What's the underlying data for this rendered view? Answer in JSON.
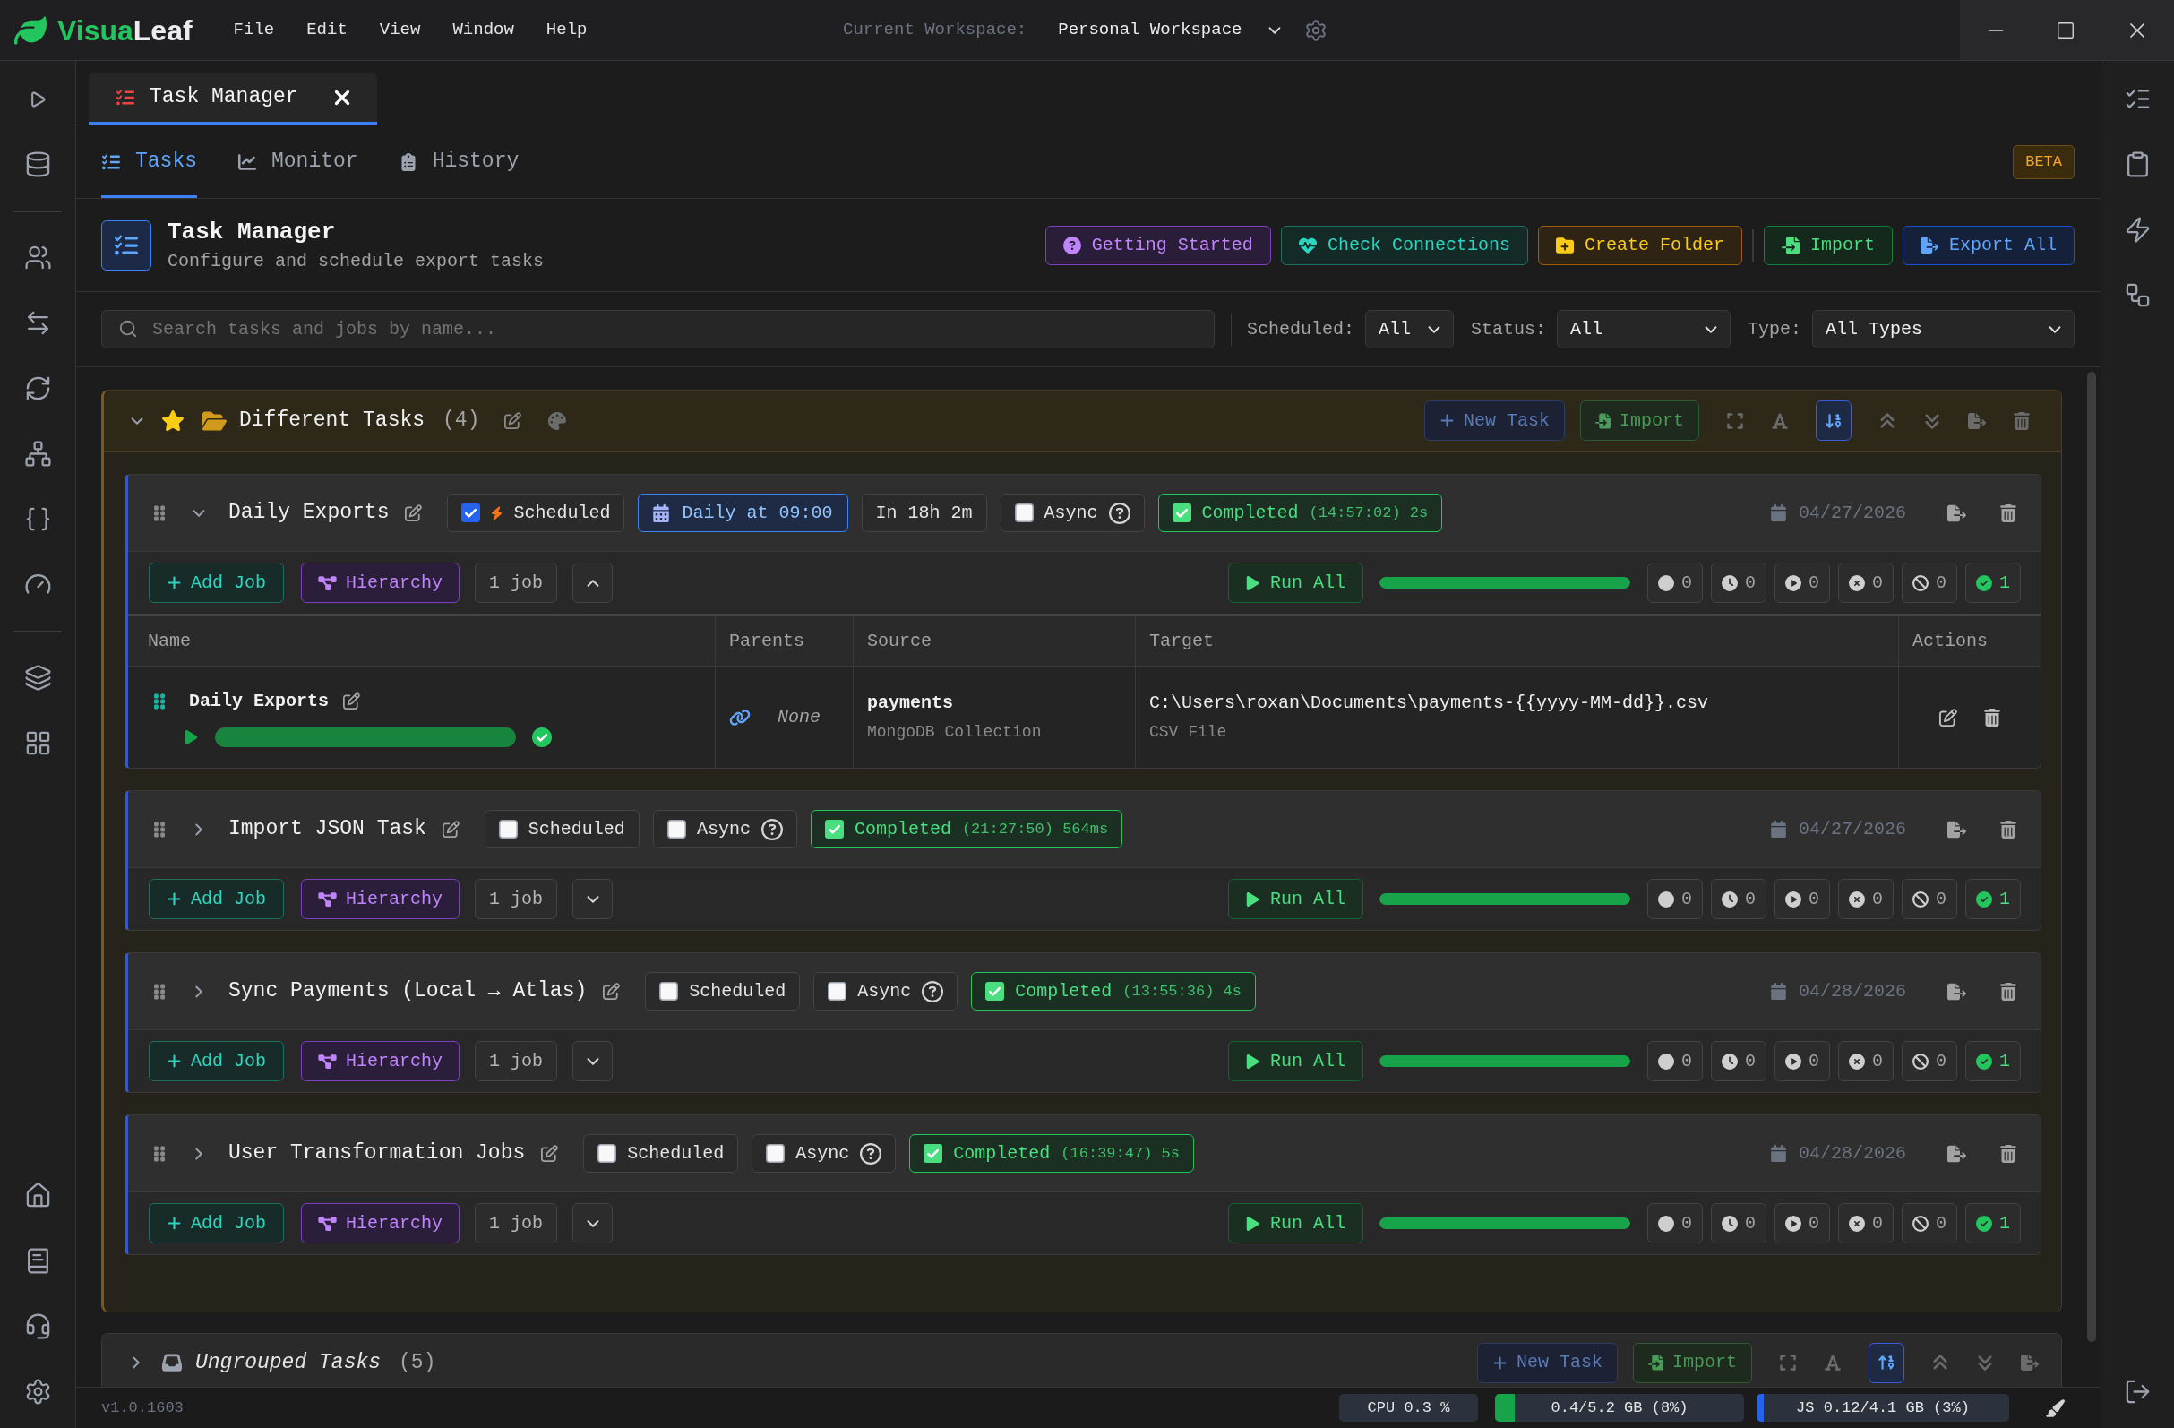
{
  "logo": {
    "accent": "Visua",
    "rest": "Leaf"
  },
  "menu": [
    "File",
    "Edit",
    "View",
    "Window",
    "Help"
  ],
  "workspace": {
    "label": "Current Workspace:",
    "value": "Personal Workspace"
  },
  "document_tabs": [
    {
      "label": "Task Manager",
      "selected": true
    }
  ],
  "view_tabs": [
    {
      "label": "Tasks",
      "selected": true
    },
    {
      "label": "Monitor",
      "selected": false
    },
    {
      "label": "History",
      "selected": false
    }
  ],
  "badge": "BETA",
  "header": {
    "title": "Task Manager",
    "subtitle": "Configure and schedule export tasks"
  },
  "setup_actions": [
    {
      "kind": "help",
      "label": "Getting Started"
    },
    {
      "kind": "connections",
      "label": "Check Connections"
    },
    {
      "kind": "folder",
      "label": "Create Folder"
    }
  ],
  "data_actions": [
    {
      "kind": "import",
      "label": "Import"
    },
    {
      "kind": "export",
      "label": "Export All"
    }
  ],
  "search": {
    "placeholder": "Search tasks and jobs by name..."
  },
  "filters": [
    {
      "label": "Scheduled:",
      "value": "All"
    },
    {
      "label": "Status:",
      "value": "All"
    },
    {
      "label": "Type:",
      "value": "All Types"
    }
  ],
  "groups": [
    {
      "kind": "folder",
      "name": "Different Tasks",
      "count": "(4)",
      "expanded": true,
      "starred": true,
      "new_task": "New Task",
      "import": "Import",
      "tasks": [
        {
          "name": "Daily Exports",
          "expanded": true,
          "scheduled": {
            "label": "Scheduled",
            "checked": true
          },
          "schedule": "Daily at 09:00",
          "next_run": "In 18h 2m",
          "async": {
            "label": "Async",
            "checked": false
          },
          "status": {
            "kind": "completed",
            "label": "Completed",
            "detail": "(14:57:02) 2s"
          },
          "date": "04/27/2026",
          "add_job": "Add Job",
          "hierarchy": "Hierarchy",
          "job_count": "1 job",
          "run_all": "Run All",
          "level": 1,
          "counters": [
            {
              "kind": "dot",
              "value": "0"
            },
            {
              "kind": "clock",
              "value": "0"
            },
            {
              "kind": "play",
              "value": "0"
            },
            {
              "kind": "cross",
              "value": "0"
            },
            {
              "kind": "ban",
              "value": "0"
            },
            {
              "kind": "check",
              "value": "1"
            }
          ],
          "jobs": {
            "columns": [
              "Name",
              "Parents",
              "Source",
              "Target",
              "Actions"
            ],
            "rows": [
              {
                "name": "Daily Exports",
                "level": 1,
                "parents": "None",
                "source": "payments",
                "source_type": "MongoDB Collection",
                "target": "C:\\Users\\roxan\\Documents\\payments-{{yyyy-MM-dd}}.csv",
                "target_type": "CSV File"
              }
            ]
          }
        },
        {
          "name": "Import JSON Task",
          "expanded": false,
          "scheduled": {
            "label": "Scheduled",
            "checked": false
          },
          "async": {
            "label": "Async",
            "checked": false
          },
          "status": {
            "kind": "completed",
            "label": "Completed",
            "detail": "(21:27:50) 564ms"
          },
          "date": "04/27/2026",
          "add_job": "Add Job",
          "hierarchy": "Hierarchy",
          "job_count": "1 job",
          "run_all": "Run All",
          "level": 1,
          "counters": [
            {
              "kind": "dot",
              "value": "0"
            },
            {
              "kind": "clock",
              "value": "0"
            },
            {
              "kind": "play",
              "value": "0"
            },
            {
              "kind": "cross",
              "value": "0"
            },
            {
              "kind": "ban",
              "value": "0"
            },
            {
              "kind": "check",
              "value": "1"
            }
          ]
        },
        {
          "name": "Sync Payments (Local → Atlas)",
          "expanded": false,
          "scheduled": {
            "label": "Scheduled",
            "checked": false
          },
          "async": {
            "label": "Async",
            "checked": false
          },
          "status": {
            "kind": "completed",
            "label": "Completed",
            "detail": "(13:55:36) 4s"
          },
          "date": "04/28/2026",
          "add_job": "Add Job",
          "hierarchy": "Hierarchy",
          "job_count": "1 job",
          "run_all": "Run All",
          "level": 1,
          "counters": [
            {
              "kind": "dot",
              "value": "0"
            },
            {
              "kind": "clock",
              "value": "0"
            },
            {
              "kind": "play",
              "value": "0"
            },
            {
              "kind": "cross",
              "value": "0"
            },
            {
              "kind": "ban",
              "value": "0"
            },
            {
              "kind": "check",
              "value": "1"
            }
          ]
        },
        {
          "name": "User Transformation Jobs",
          "expanded": false,
          "scheduled": {
            "label": "Scheduled",
            "checked": false
          },
          "async": {
            "label": "Async",
            "checked": false
          },
          "status": {
            "kind": "completed",
            "label": "Completed",
            "detail": "(16:39:47) 5s"
          },
          "date": "04/28/2026",
          "add_job": "Add Job",
          "hierarchy": "Hierarchy",
          "job_count": "1 job",
          "run_all": "Run All",
          "level": 1,
          "counters": [
            {
              "kind": "dot",
              "value": "0"
            },
            {
              "kind": "clock",
              "value": "0"
            },
            {
              "kind": "play",
              "value": "0"
            },
            {
              "kind": "cross",
              "value": "0"
            },
            {
              "kind": "ban",
              "value": "0"
            },
            {
              "kind": "check",
              "value": "1"
            }
          ]
        }
      ]
    },
    {
      "kind": "ungrouped",
      "name": "Ungrouped Tasks",
      "count": "(5)",
      "expanded": false,
      "new_task": "New Task",
      "import": "Import"
    }
  ],
  "status_bar": {
    "version": "v1.0.1603",
    "cpu": "CPU 0.3 %",
    "memory": {
      "label": "0.4/5.2 GB (8%)",
      "level": 0.08
    },
    "js_heap": {
      "label": "JS 0.12/4.1 GB (3%)",
      "level": 0.03
    }
  }
}
